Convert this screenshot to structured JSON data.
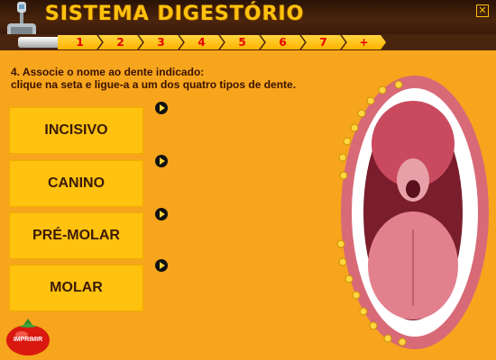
{
  "app": {
    "title": "SISTEMA DIGESTÓRIO",
    "close_label": "✕"
  },
  "steps": [
    "1",
    "2",
    "3",
    "4",
    "5",
    "6",
    "7",
    "+"
  ],
  "instructions": {
    "line1": "4. Associe o nome ao dente indicado:",
    "line2": "clique na seta e ligue-a a um dos quatro tipos de dente."
  },
  "options": [
    {
      "label": "INCISIVO"
    },
    {
      "label": "CANINO"
    },
    {
      "label": "PRÉ-MOLAR"
    },
    {
      "label": "MOLAR"
    }
  ],
  "print_button": {
    "label": "IMPRIMIR"
  },
  "colors": {
    "background": "#f7a51c",
    "box": "#ffc20e",
    "header": "#4a250d",
    "title": "#ffc20e",
    "step_number": "#e30000"
  }
}
